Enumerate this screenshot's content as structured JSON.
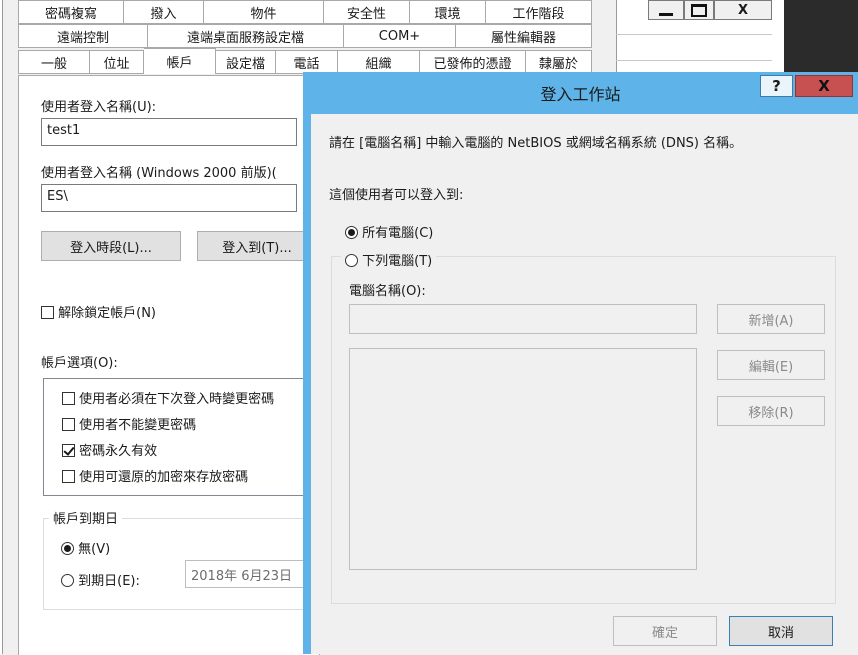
{
  "property_dialog": {
    "tab_rows": [
      [
        "密碼複寫",
        "撥入",
        "物件",
        "安全性",
        "環境",
        "工作階段"
      ],
      [
        "遠端控制",
        "遠端桌面服務設定檔",
        "COM+",
        "屬性編輯器"
      ],
      [
        "一般",
        "位址",
        "帳戶",
        "設定檔",
        "電話",
        "組織",
        "已發佈的憑證",
        "隸屬於"
      ]
    ],
    "logon_name_label": "使用者登入名稱(U):",
    "logon_name_value": "test1",
    "logon_name_pre2000_label": "使用者登入名稱 (Windows 2000 前版)(",
    "logon_name_pre2000_value": "ES\\",
    "logon_hours_button": "登入時段(L)...",
    "logon_to_button": "登入到(T)...",
    "unlock_account_label": "解除鎖定帳戶(N)",
    "account_options_label": "帳戶選項(O):",
    "account_options": [
      {
        "label": "使用者必須在下次登入時變更密碼",
        "checked": false
      },
      {
        "label": "使用者不能變更密碼",
        "checked": false
      },
      {
        "label": "密碼永久有效",
        "checked": true
      },
      {
        "label": "使用可還原的加密來存放密碼",
        "checked": false
      }
    ],
    "account_expires_label": "帳戶到期日",
    "never_label": "無(V)",
    "end_of_label": "到期日(E):",
    "expiry_date_value": "2018年  6月23日"
  },
  "background_window": {
    "minimize_icon": "minimize-icon",
    "maximize_icon": "maximize-icon",
    "close_label": "X"
  },
  "logon_workstations_dialog": {
    "title": "登入工作站",
    "help_label": "?",
    "close_label": "X",
    "instruction": "請在 [電腦名稱] 中輸入電腦的 NetBIOS 或網域名稱系統 (DNS) 名稱。",
    "logon_to_label": "這個使用者可以登入到:",
    "all_computers_label": "所有電腦(C)",
    "following_computers_label": "下列電腦(T)",
    "computer_name_label": "電腦名稱(O):",
    "computer_name_value": "",
    "add_button": "新增(A)",
    "edit_button": "編輯(E)",
    "remove_button": "移除(R)",
    "ok_button": "確定",
    "cancel_button": "取消"
  },
  "colors": {
    "title_bar": "#5eb4e8",
    "close_button": "#c75050"
  }
}
